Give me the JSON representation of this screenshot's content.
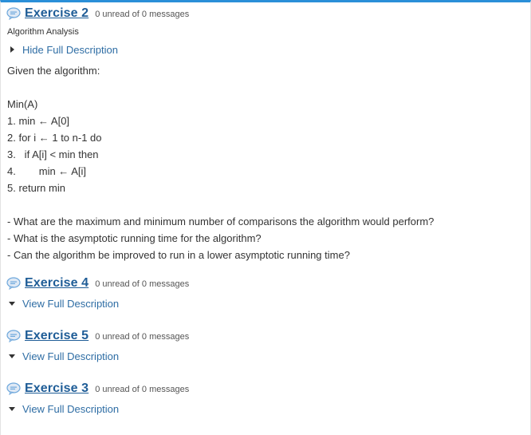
{
  "topics": [
    {
      "title": "Exercise 2",
      "unread": "0 unread of 0 messages",
      "subtitle": "Algorithm Analysis",
      "toggle_label": "Hide Full Description",
      "expanded": true,
      "description_lines": [
        "Given the algorithm:",
        "",
        "Min(A)",
        "1. min ← A[0]",
        "2. for i ← 1 to n-1 do",
        "3.   if A[i] < min then",
        "4.        min ← A[i]",
        "5. return min",
        "",
        "- What are the maximum and minimum number of comparisons the algorithm would perform?",
        "- What is the asymptotic running time for the algorithm?",
        "- Can the algorithm be improved to run in a lower asymptotic running time?"
      ]
    },
    {
      "title": "Exercise 4",
      "unread": "0 unread of 0 messages",
      "toggle_label": "View Full Description",
      "expanded": false
    },
    {
      "title": "Exercise 5",
      "unread": "0 unread of 0 messages",
      "toggle_label": "View Full Description",
      "expanded": false
    },
    {
      "title": "Exercise 3",
      "unread": "0 unread of 0 messages",
      "toggle_label": "View Full Description",
      "expanded": false
    }
  ],
  "colors": {
    "accent": "#2a8fd8",
    "title_link": "#1f5d97",
    "toggle_link": "#2e6da4",
    "bubble": "#6fa8dc"
  },
  "icons": {
    "topic": "speech-bubble-icon",
    "expanded_arrow": "triangle-right-icon",
    "collapsed_arrow": "triangle-down-icon"
  }
}
